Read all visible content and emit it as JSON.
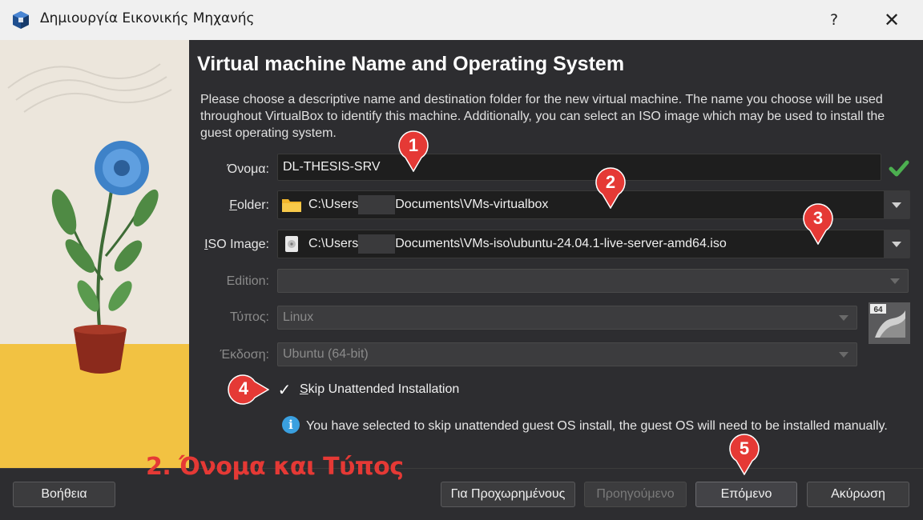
{
  "window": {
    "title": "Δημιουργία Εικονικής Μηχανής",
    "help_label": "?",
    "close_label": "✕"
  },
  "page": {
    "heading": "Virtual machine Name and Operating System",
    "description": "Please choose a descriptive name and destination folder for the new virtual machine. The name you choose will be used throughout VirtualBox to identify this machine. Additionally, you can select an ISO image which may be used to install the guest operating system."
  },
  "form": {
    "name": {
      "label": "Όνομα:",
      "value": "DL-THESIS-SRV"
    },
    "folder": {
      "label_prefix": "",
      "label_accel": "F",
      "label_rest": "older:",
      "value_pre": "C:\\Users",
      "value_post": "Documents\\VMs-virtualbox"
    },
    "iso": {
      "label_accel": "I",
      "label_rest": "SO Image:",
      "value_pre": "C:\\Users",
      "value_post": "Documents\\VMs-iso\\ubuntu-24.04.1-live-server-amd64.iso"
    },
    "edition": {
      "label": "Edition:",
      "value": ""
    },
    "type": {
      "label": "Τύπος:",
      "value": "Linux"
    },
    "version": {
      "label": "Έκδοση:",
      "value": "Ubuntu (64-bit)"
    },
    "os_badge": "64"
  },
  "skip_unattended": {
    "checked": true,
    "check_glyph": "✓",
    "label_accel": "S",
    "label_rest": "kip Unattended Installation"
  },
  "info": {
    "icon": "i",
    "text": "You have selected to skip unattended guest OS install, the guest OS will need to be installed manually."
  },
  "footer": {
    "help": "Βοήθεια",
    "expert": "Για Προχωρημένους",
    "back": "Προηγούμενο",
    "next": "Επόμενο",
    "cancel": "Ακύρωση"
  },
  "overlay": {
    "title": "2. Όνομα και Τύπος",
    "markers": [
      "1",
      "2",
      "3",
      "4",
      "5"
    ],
    "marker_color": "#e53935"
  },
  "colors": {
    "background": "#2d2d30",
    "field": "#1e1e1e",
    "accent_check": "#4caf50",
    "info_blue": "#3aa0e0"
  }
}
